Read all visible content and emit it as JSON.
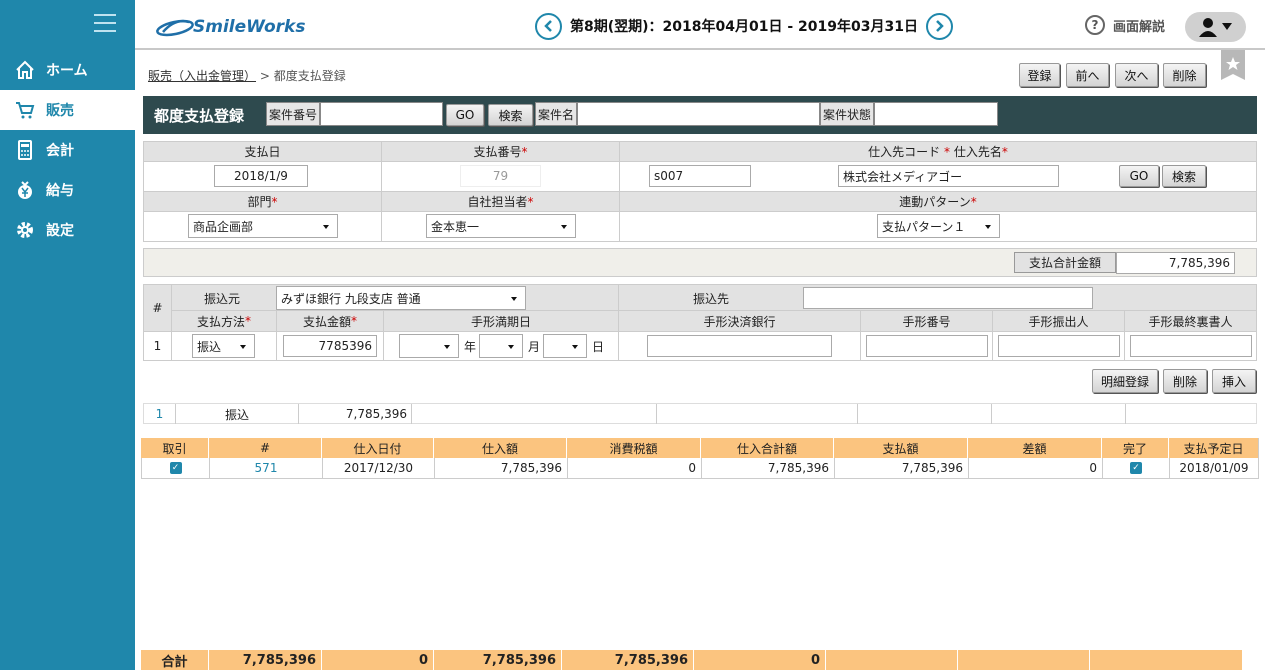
{
  "app": {
    "logo": "SmileWorks"
  },
  "header": {
    "period": "第8期(翌期)：2018年04月01日 - 2019年03月31日",
    "help": "画面解説"
  },
  "sidebar": {
    "items": [
      {
        "label": "ホーム",
        "icon": "home-icon"
      },
      {
        "label": "販売",
        "icon": "cart-icon"
      },
      {
        "label": "会計",
        "icon": "calculator-icon"
      },
      {
        "label": "給与",
        "icon": "yen-bag-icon"
      },
      {
        "label": "設定",
        "icon": "gear-icon"
      }
    ]
  },
  "breadcrumb": {
    "parent": "販売（入出金管理）",
    "sep": " > ",
    "current": "都度支払登録"
  },
  "toolbar": {
    "register": "登録",
    "prev": "前へ",
    "next": "次へ",
    "delete": "削除"
  },
  "title": {
    "text": "都度支払登録",
    "case_no_label": "案件番号",
    "go": "GO",
    "search": "検索",
    "case_name_label": "案件名",
    "case_status_label": "案件状態"
  },
  "form": {
    "pay_date_label": "支払日",
    "pay_date": "2018/1/9",
    "pay_no_label": "支払番号",
    "pay_no": "79",
    "supplier_label": "仕入先コード",
    "supplier_name_label": "仕入先名",
    "supplier_code": "s007",
    "supplier_name": "株式会社メディアゴー",
    "go": "GO",
    "search": "検索",
    "dept_label": "部門",
    "dept": "商品企画部",
    "staff_label": "自社担当者",
    "staff": "金本恵一",
    "pattern_label": "連動パターン",
    "pattern": "支払パターン１"
  },
  "total": {
    "label": "支払合計金額",
    "value": "7,785,396"
  },
  "detail": {
    "hash": "#",
    "from_label": "振込元",
    "from_value": "みずほ銀行 九段支店 普通",
    "to_label": "振込先",
    "method_label": "支払方法",
    "amount_label": "支払金額",
    "due_label": "手形満期日",
    "bank_label": "手形決済銀行",
    "note_no_label": "手形番号",
    "drawer_label": "手形振出人",
    "endorser_label": "手形最終裏書人",
    "row_no": "1",
    "method": "振込",
    "amount": "7785396",
    "year": "年",
    "month": "月",
    "day": "日",
    "detail_register": "明細登録",
    "delete": "削除",
    "insert": "挿入"
  },
  "summary_row": {
    "no": "1",
    "method": "振込",
    "amount": "7,785,396"
  },
  "orders": {
    "headers": [
      "取引",
      "#",
      "仕入日付",
      "仕入額",
      "消費税額",
      "仕入合計額",
      "支払額",
      "差額",
      "完了",
      "支払予定日"
    ],
    "rows": [
      {
        "no": "571",
        "date": "2017/12/30",
        "purchase": "7,785,396",
        "tax": "0",
        "total": "7,785,396",
        "paid": "7,785,396",
        "diff": "0",
        "due": "2018/01/09"
      }
    ]
  },
  "footer": {
    "label": "合計",
    "v1": "7,785,396",
    "v2": "0",
    "v3": "7,785,396",
    "v4": "7,785,396",
    "v5": "0"
  }
}
